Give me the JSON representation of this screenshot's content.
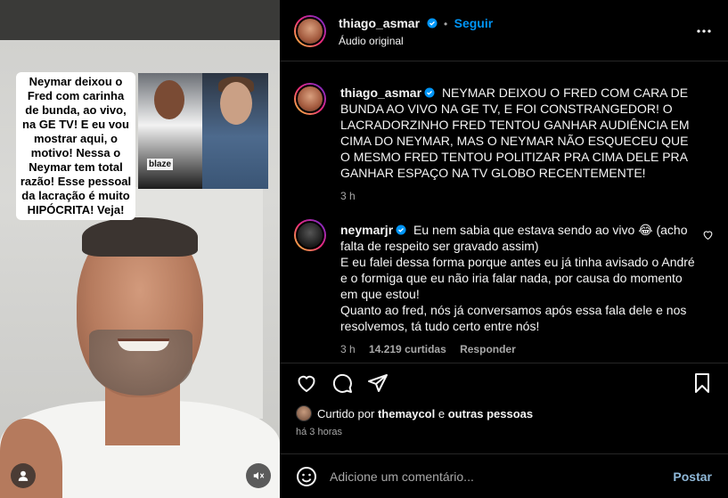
{
  "video": {
    "caption": "Neymar deixou o Fred com carinha de bunda, ao vivo, na GE TV! E eu vou mostrar aqui, o motivo! Nessa o Neymar tem total razão! Esse pessoal da lacração é muito HIPÓCRITA! Veja!",
    "shirt_text": "blaze"
  },
  "post": {
    "author": "thiago_asmar",
    "follow_label": "Seguir",
    "separator": "•",
    "audio_label": "Áudio original"
  },
  "caption_comment": {
    "username": "thiago_asmar",
    "text": "NEYMAR DEIXOU O FRED COM CARA DE BUNDA AO VIVO NA GE TV, E FOI CONSTRANGEDOR! O LACRADORZINHO FRED TENTOU GANHAR AUDIÊNCIA EM CIMA DO NEYMAR, MAS O NEYMAR NÃO ESQUECEU QUE O MESMO FRED TENTOU POLITIZAR PRA CIMA DELE PRA GANHAR ESPAÇO NA TV GLOBO RECENTEMENTE!",
    "time": "3 h"
  },
  "reply": {
    "username": "neymarjr",
    "line1": "Eu nem sabia que estava sendo ao vivo 😂 (acho falta de respeito ser gravado assim)",
    "line2": "E eu falei dessa forma porque antes eu já tinha avisado o André e o formiga que eu não iria falar nada, por causa do momento em que estou!",
    "line3": "Quanto ao fred, nós já conversamos após essa fala dele e nos resolvemos, tá tudo certo entre nós!",
    "time": "3 h",
    "likes": "14.219 curtidas",
    "reply_label": "Responder"
  },
  "likes": {
    "prefix": "Curtido por",
    "user": "themaycol",
    "connector": "e",
    "others": "outras pessoas"
  },
  "timestamp": "há 3 horas",
  "composer": {
    "placeholder": "Adicione um comentário...",
    "post_label": "Postar"
  },
  "icons": [
    "more-icon",
    "heart-icon",
    "comment-icon",
    "share-icon",
    "bookmark-icon",
    "emoji-icon",
    "user-icon",
    "mute-icon",
    "verified-icon"
  ],
  "colors": {
    "accent": "#0095f6",
    "verified": "#0095f6",
    "muted_text": "#a8a8a8",
    "background": "#000000"
  }
}
